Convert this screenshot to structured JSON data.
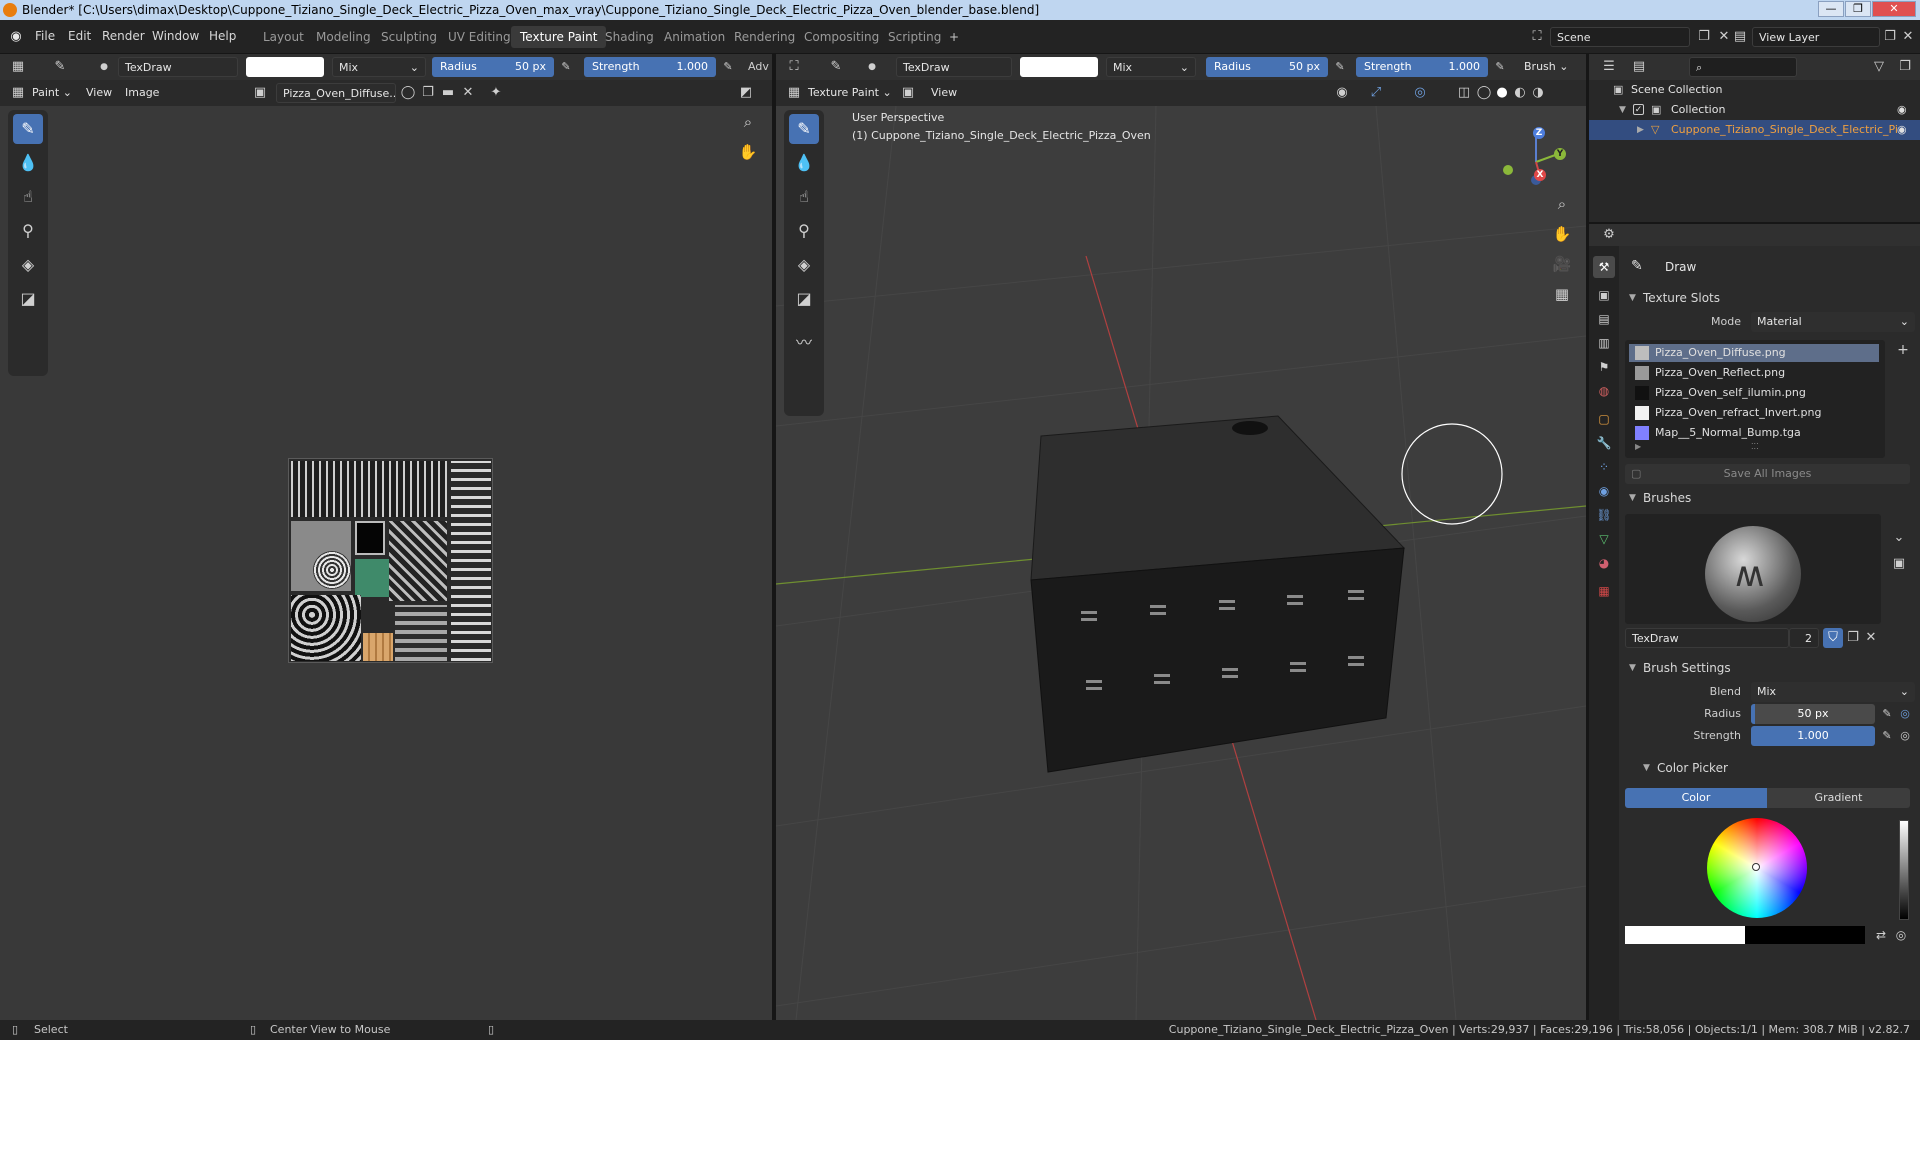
{
  "title_bar": {
    "text": "Blender* [C:\\Users\\dimax\\Desktop\\Cuppone_Tiziano_Single_Deck_Electric_Pizza_Oven_max_vray\\Cuppone_Tiziano_Single_Deck_Electric_Pizza_Oven_blender_base.blend]",
    "minimize": "—",
    "maximize": "❐",
    "close": "✕"
  },
  "menu": [
    "File",
    "Edit",
    "Render",
    "Window",
    "Help"
  ],
  "workspaces": [
    {
      "label": "Layout",
      "active": false
    },
    {
      "label": "Modeling",
      "active": false
    },
    {
      "label": "Sculpting",
      "active": false
    },
    {
      "label": "UV Editing",
      "active": false
    },
    {
      "label": "Texture Paint",
      "active": true
    },
    {
      "label": "Shading",
      "active": false
    },
    {
      "label": "Animation",
      "active": false
    },
    {
      "label": "Rendering",
      "active": false
    },
    {
      "label": "Compositing",
      "active": false
    },
    {
      "label": "Scripting",
      "active": false
    }
  ],
  "add_workspace": "+",
  "scene": {
    "label": "Scene",
    "view_layer": "View Layer"
  },
  "image_editor": {
    "brush_name": "TexDraw",
    "blend": "Mix",
    "radius_label": "Radius",
    "radius_value": "50 px",
    "strength_label": "Strength",
    "strength_value": "1.000",
    "adv": "Adv",
    "mode": "Paint",
    "view": "View",
    "image_menu": "Image",
    "image_name": "Pizza_Oven_Diffuse..."
  },
  "viewport": {
    "brush_name": "TexDraw",
    "blend": "Mix",
    "radius_label": "Radius",
    "radius_value": "50 px",
    "strength_label": "Strength",
    "strength_value": "1.000",
    "brush_menu": "Brush",
    "mode": "Texture Paint",
    "view": "View",
    "perspective": "User Perspective",
    "object_label": "(1) Cuppone_Tiziano_Single_Deck_Electric_Pizza_Oven",
    "axes": {
      "x": "X",
      "y": "Y",
      "z": "Z"
    }
  },
  "outliner": {
    "scene_collection": "Scene Collection",
    "collection": "Collection",
    "object": "Cuppone_Tiziano_Single_Deck_Electric_Pizza_Oven"
  },
  "properties": {
    "tool_name": "Draw",
    "texture_slots": {
      "header": "Texture Slots",
      "mode_label": "Mode",
      "mode_value": "Material",
      "slots": [
        {
          "name": "Pizza_Oven_Diffuse.png",
          "selected": true,
          "swatch": "#bdbdbd"
        },
        {
          "name": "Pizza_Oven_Reflect.png",
          "selected": false,
          "swatch": "#9a9a9a"
        },
        {
          "name": "Pizza_Oven_self_ilumin.png",
          "selected": false,
          "swatch": "#111111"
        },
        {
          "name": "Pizza_Oven_refract_Invert.png",
          "selected": false,
          "swatch": "#f2f2f2"
        },
        {
          "name": "Map__5_Normal_Bump.tga",
          "selected": false,
          "swatch": "#8080ff"
        }
      ],
      "save_all": "Save All Images"
    },
    "brushes": {
      "header": "Brushes",
      "brush_name": "TexDraw",
      "users": "2"
    },
    "brush_settings": {
      "header": "Brush Settings",
      "blend_label": "Blend",
      "blend_value": "Mix",
      "radius_label": "Radius",
      "radius_value": "50 px",
      "strength_label": "Strength",
      "strength_value": "1.000"
    },
    "color_picker": {
      "header": "Color Picker",
      "tab_color": "Color",
      "tab_gradient": "Gradient"
    }
  },
  "status_bar": {
    "select": "Select",
    "center_view": "Center View to Mouse",
    "stats": "Cuppone_Tiziano_Single_Deck_Electric_Pizza_Oven | Verts:29,937 | Faces:29,196 | Tris:58,056 | Objects:1/1 | Mem: 308.7 MiB | v2.82.7"
  }
}
